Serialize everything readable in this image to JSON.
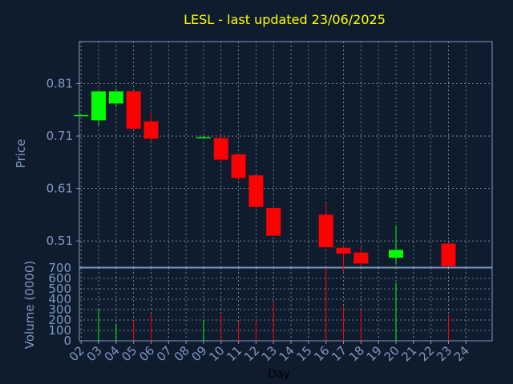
{
  "chart_data": {
    "type": "candlestick",
    "title": "LESL - last updated 23/06/2025",
    "price_panel": {
      "ylabel": "Price",
      "yticks": [
        "0.51",
        "0.61",
        "0.71",
        "0.81"
      ],
      "ylim": [
        0.46,
        0.89
      ]
    },
    "volume_panel": {
      "ylabel": "Volume (0000)",
      "yticks": [
        "0",
        "100",
        "200",
        "300",
        "400",
        "500",
        "600",
        "700"
      ],
      "ylim": [
        0,
        700
      ]
    },
    "xlabel": "Day",
    "x_tick_labels": [
      "02",
      "03",
      "04",
      "05",
      "06",
      "07",
      "08",
      "09",
      "10",
      "11",
      "12",
      "13",
      "14",
      "15",
      "16",
      "17",
      "18",
      "19",
      "20",
      "21",
      "22",
      "23",
      "24"
    ],
    "candles": [
      {
        "day": "02",
        "open": 0.75,
        "high": 0.75,
        "low": 0.75,
        "close": 0.75,
        "volume": 0
      },
      {
        "day": "03",
        "open": 0.74,
        "high": 0.795,
        "low": 0.73,
        "close": 0.795,
        "volume": 300
      },
      {
        "day": "04",
        "open": 0.772,
        "high": 0.8,
        "low": 0.765,
        "close": 0.795,
        "volume": 165
      },
      {
        "day": "05",
        "open": 0.795,
        "high": 0.795,
        "low": 0.724,
        "close": 0.724,
        "volume": 195
      },
      {
        "day": "06",
        "open": 0.738,
        "high": 0.755,
        "low": 0.7,
        "close": 0.705,
        "volume": 260
      },
      {
        "day": "09",
        "open": 0.707,
        "high": 0.71,
        "low": 0.706,
        "close": 0.708,
        "volume": 195
      },
      {
        "day": "10",
        "open": 0.706,
        "high": 0.715,
        "low": 0.66,
        "close": 0.665,
        "volume": 260
      },
      {
        "day": "11",
        "open": 0.675,
        "high": 0.675,
        "low": 0.625,
        "close": 0.63,
        "volume": 185
      },
      {
        "day": "12",
        "open": 0.635,
        "high": 0.635,
        "low": 0.572,
        "close": 0.575,
        "volume": 195
      },
      {
        "day": "13",
        "open": 0.573,
        "high": 0.573,
        "low": 0.52,
        "close": 0.52,
        "volume": 380
      },
      {
        "day": "16",
        "open": 0.56,
        "high": 0.583,
        "low": 0.498,
        "close": 0.498,
        "volume": 700
      },
      {
        "day": "17",
        "open": 0.497,
        "high": 0.5,
        "low": 0.45,
        "close": 0.486,
        "volume": 330
      },
      {
        "day": "18",
        "open": 0.488,
        "high": 0.5,
        "low": 0.462,
        "close": 0.467,
        "volume": 300
      },
      {
        "day": "20",
        "open": 0.478,
        "high": 0.54,
        "low": 0.465,
        "close": 0.493,
        "volume": 560
      },
      {
        "day": "23",
        "open": 0.505,
        "high": 0.505,
        "low": 0.462,
        "close": 0.462,
        "volume": 250
      }
    ],
    "grid": true,
    "colors": {
      "background": "#0f1c2e",
      "up": "#00ff00",
      "down": "#ff0000",
      "title": "#ffff00",
      "text": "#7f98c2",
      "grid": "#8a9bb5"
    }
  }
}
